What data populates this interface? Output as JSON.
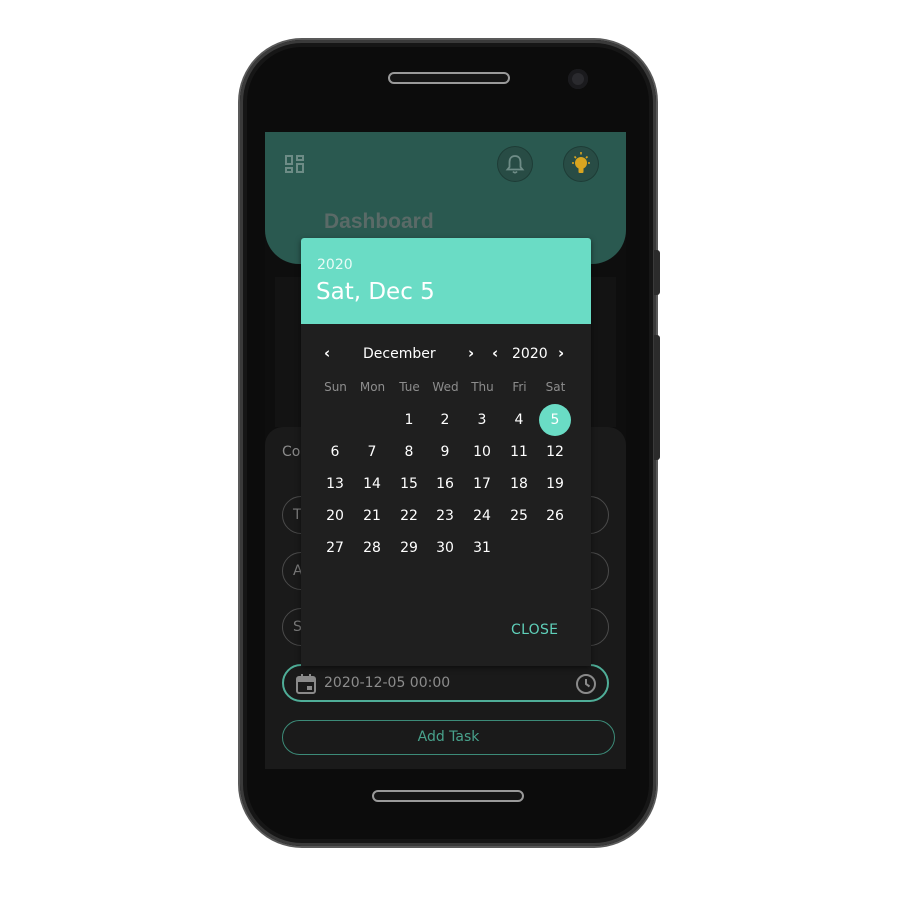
{
  "dashboard": {
    "title": "Dashboard",
    "header_color": "#2a5950",
    "icons": {
      "menu": "apps-icon",
      "notifications": "bell-icon",
      "theme": "lightbulb-icon"
    }
  },
  "form": {
    "section_label": "Co",
    "fields": [
      "T",
      "A",
      "S"
    ],
    "date_value": "2020-12-05 00:00",
    "add_task_label": "Add Task"
  },
  "date_picker": {
    "header_year": "2020",
    "header_date": "Sat, Dec 5",
    "month_label": "December",
    "year_label": "2020",
    "weekdays": [
      "Sun",
      "Mon",
      "Tue",
      "Wed",
      "Thu",
      "Fri",
      "Sat"
    ],
    "days": [
      "1",
      "2",
      "3",
      "4",
      "5",
      "6",
      "7",
      "8",
      "9",
      "10",
      "11",
      "12",
      "13",
      "14",
      "15",
      "16",
      "17",
      "18",
      "19",
      "20",
      "21",
      "22",
      "23",
      "24",
      "25",
      "26",
      "27",
      "28",
      "29",
      "30",
      "31"
    ],
    "first_weekday_index": 2,
    "selected_day": "5",
    "close_label": "CLOSE",
    "accent_color": "#6adcc5"
  }
}
